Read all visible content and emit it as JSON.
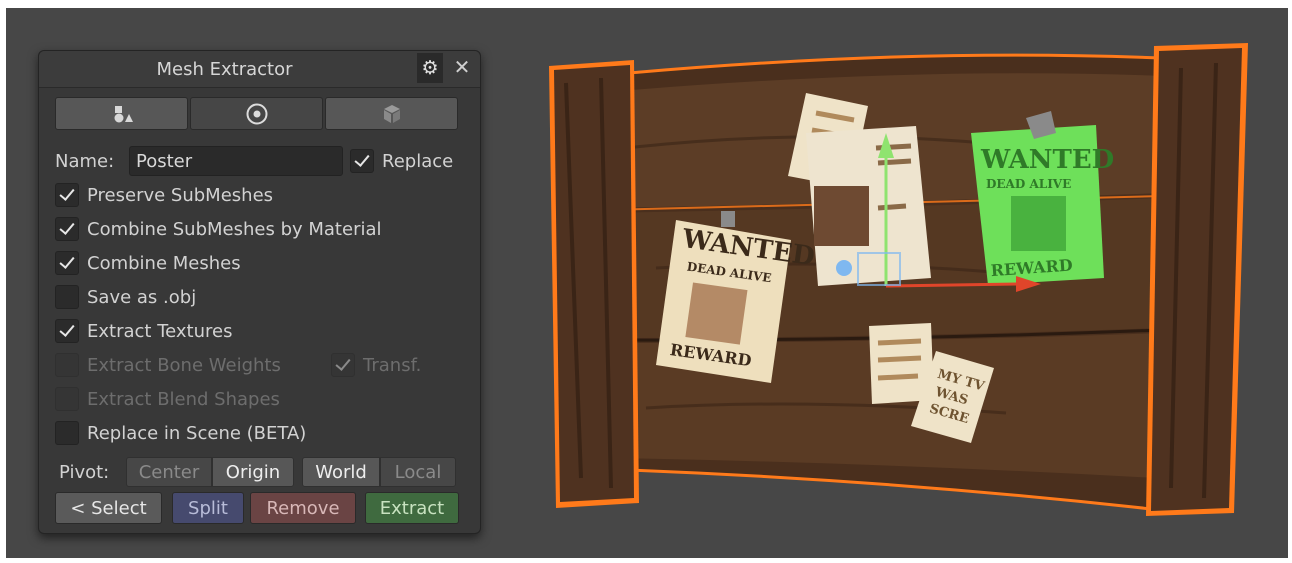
{
  "window": {
    "title": "Mesh Extractor",
    "icons": {
      "settings": "gear-icon",
      "close": "close-icon"
    }
  },
  "mode_tabs": [
    {
      "icon": "shapes-icon",
      "active": false
    },
    {
      "icon": "target-icon",
      "active": true
    },
    {
      "icon": "cube-icon",
      "active": false
    }
  ],
  "name_field": {
    "label": "Name:",
    "value": "Poster"
  },
  "replace": {
    "label": "Replace",
    "checked": true
  },
  "options": [
    {
      "label": "Preserve SubMeshes",
      "checked": true,
      "enabled": true
    },
    {
      "label": "Combine SubMeshes by Material",
      "checked": true,
      "enabled": true
    },
    {
      "label": "Combine Meshes",
      "checked": true,
      "enabled": true
    },
    {
      "label": "Save as .obj",
      "checked": false,
      "enabled": true
    },
    {
      "label": "Extract Textures",
      "checked": true,
      "enabled": true
    },
    {
      "label": "Extract Bone Weights",
      "checked": false,
      "enabled": false
    },
    {
      "label": "Extract Blend Shapes",
      "checked": false,
      "enabled": false
    },
    {
      "label": "Replace in Scene (BETA)",
      "checked": false,
      "enabled": true
    }
  ],
  "transf": {
    "label": "Transf.",
    "checked": true,
    "enabled": false
  },
  "pivot": {
    "label": "Pivot:",
    "center": "Center",
    "origin": "Origin",
    "world": "World",
    "local": "Local",
    "selected": [
      "Origin",
      "World"
    ]
  },
  "actions": {
    "select": "< Select",
    "split": "Split",
    "remove": "Remove",
    "extract": "Extract"
  },
  "scene": {
    "poster_left": {
      "line1": "WANTED",
      "line2": "DEAD ALIVE",
      "line3": "REWARD"
    },
    "poster_right": {
      "line1": "WANTED",
      "line2": "DEAD ALIVE",
      "line3": "REWARD"
    },
    "note": {
      "line1": "MY TV",
      "line2": "WAS",
      "line3": "SCRE"
    },
    "colors": {
      "selection_outline": "#ff7a1a",
      "selected_poster": "#6ee05a",
      "wood": "#5a3c26"
    }
  }
}
